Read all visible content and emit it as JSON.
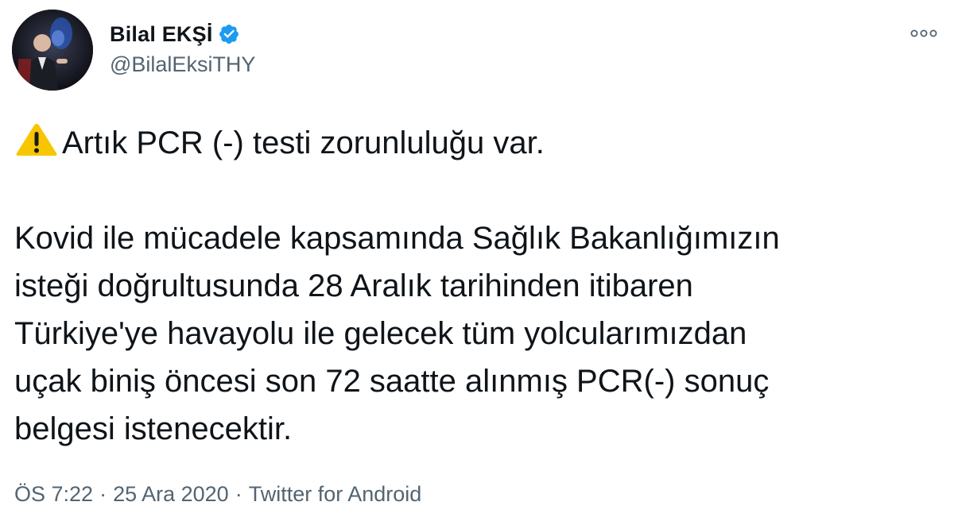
{
  "author": {
    "display_name": "Bilal EKŞİ",
    "handle": "@BilalEksiTHY",
    "verified_icon": "verified-badge-icon",
    "avatar_icon": "profile-photo"
  },
  "menu": {
    "icon": "more-options-icon"
  },
  "tweet": {
    "warning_icon": "warning-sign-icon",
    "line_1": "Artık PCR (-) testi zorunluluğu var.",
    "paragraph_lines": [
      "Kovid ile mücadele kapsamında Sağlık Bakanlığımızın",
      "isteği doğrultusunda 28 Aralık tarihinden itibaren",
      "Türkiye'ye havayolu ile gelecek tüm yolcularımızdan",
      "uçak biniş öncesi son 72 saatte alınmış PCR(-) sonuç",
      "belgesi istenecektir."
    ]
  },
  "meta": {
    "time": "ÖS 7:22",
    "separator": "·",
    "date": "25 Ara 2020",
    "source": "Twitter for Android"
  },
  "colors": {
    "text": "#0f1419",
    "secondary": "#536471",
    "verified_blue": "#1d9bf0",
    "warning_yellow": "#f7c600"
  }
}
